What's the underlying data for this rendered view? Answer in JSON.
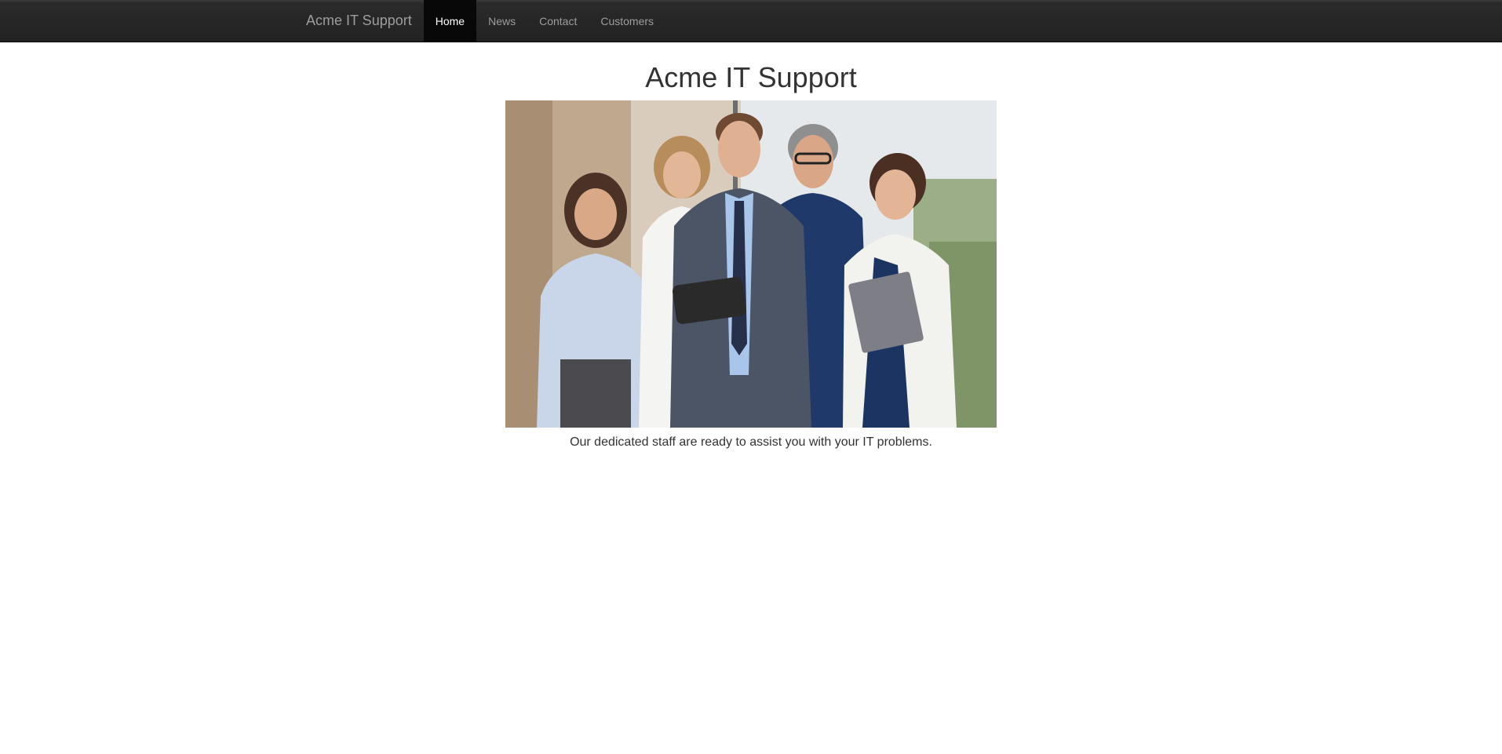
{
  "navbar": {
    "brand": "Acme IT Support",
    "items": [
      {
        "label": "Home",
        "active": true
      },
      {
        "label": "News",
        "active": false
      },
      {
        "label": "Contact",
        "active": false
      },
      {
        "label": "Customers",
        "active": false
      }
    ]
  },
  "main": {
    "title": "Acme IT Support",
    "hero_image": "team-photo",
    "caption": "Our dedicated staff are ready to assist you with your IT problems."
  },
  "colors": {
    "navbar_bg": "#222222",
    "nav_active_bg": "#080808",
    "nav_text": "#9d9d9d",
    "nav_active_text": "#ffffff",
    "body_text": "#333333"
  }
}
